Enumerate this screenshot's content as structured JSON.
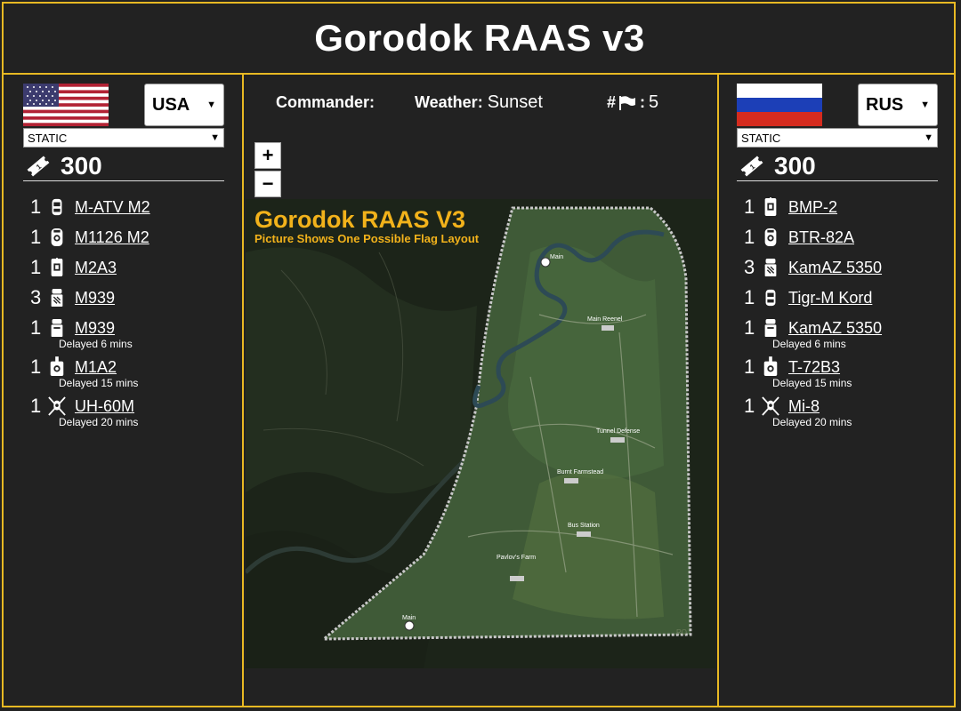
{
  "title": "Gorodok RAAS v3",
  "colors": {
    "accent": "#e8b923",
    "background": "#222222",
    "map_title": "#f2b21b"
  },
  "blufor": {
    "faction": "USA",
    "unit_type": "STATIC",
    "tickets": "300",
    "units": [
      {
        "count": "1",
        "name": "M-ATV M2",
        "icon": "jeep-icon",
        "delay": ""
      },
      {
        "count": "1",
        "name": "M1126 M2",
        "icon": "apc-icon",
        "delay": ""
      },
      {
        "count": "1",
        "name": "M2A3",
        "icon": "ifv-icon",
        "delay": ""
      },
      {
        "count": "3",
        "name": "M939",
        "icon": "logistics-truck-icon",
        "delay": ""
      },
      {
        "count": "1",
        "name": "M939",
        "icon": "transport-truck-icon",
        "delay": "Delayed 6 mins"
      },
      {
        "count": "1",
        "name": "M1A2",
        "icon": "tank-icon",
        "delay": "Delayed 15 mins"
      },
      {
        "count": "1",
        "name": "UH-60M",
        "icon": "helicopter-icon",
        "delay": "Delayed 20 mins"
      }
    ]
  },
  "opfor": {
    "faction": "RUS",
    "unit_type": "STATIC",
    "tickets": "300",
    "units": [
      {
        "count": "1",
        "name": "BMP-2",
        "icon": "ifv-icon",
        "delay": ""
      },
      {
        "count": "1",
        "name": "BTR-82A",
        "icon": "apc-icon",
        "delay": ""
      },
      {
        "count": "3",
        "name": "KamAZ 5350",
        "icon": "logistics-truck-icon",
        "delay": ""
      },
      {
        "count": "1",
        "name": "Tigr-M Kord",
        "icon": "jeep-icon",
        "delay": ""
      },
      {
        "count": "1",
        "name": "KamAZ 5350",
        "icon": "transport-truck-icon",
        "delay": "Delayed 6 mins"
      },
      {
        "count": "1",
        "name": "T-72B3",
        "icon": "tank-icon",
        "delay": "Delayed 15 mins"
      },
      {
        "count": "1",
        "name": "Mi-8",
        "icon": "helicopter-icon",
        "delay": "Delayed 20 mins"
      }
    ]
  },
  "info": {
    "commander_label": "Commander:",
    "commander_value": "",
    "weather_label": "Weather:",
    "weather_value": "Sunset",
    "flags_label": "#",
    "flags_value": "5"
  },
  "map": {
    "zoom_in": "+",
    "zoom_out": "−",
    "title": "Gorodok RAAS V3",
    "subtitle": "Picture Shows One Possible Flag Layout",
    "labels": [
      "Main",
      "Main Reenel",
      "Tunnel Defense",
      "Burnt Farmstead",
      "Bus Station",
      "Pavlov's Farm",
      "Main"
    ]
  }
}
